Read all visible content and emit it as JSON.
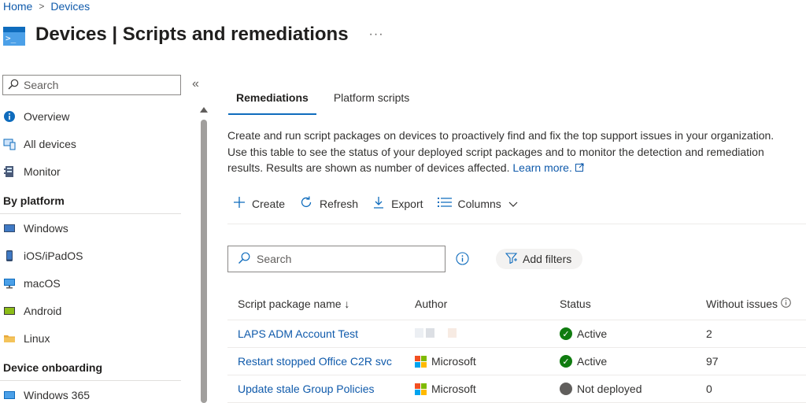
{
  "breadcrumb": {
    "home": "Home",
    "separator": ">",
    "current": "Devices"
  },
  "header": {
    "title_bold": "Devices",
    "title_rest": " | Scripts and remediations",
    "more": "···"
  },
  "sidebar": {
    "search_placeholder": "Search",
    "collapse": "«",
    "top_items": [
      {
        "label": "Overview",
        "icon": "info-icon"
      },
      {
        "label": "All devices",
        "icon": "devices-icon"
      },
      {
        "label": "Monitor",
        "icon": "monitor-icon"
      }
    ],
    "section_platform": "By platform",
    "platform_items": [
      {
        "label": "Windows",
        "icon": "windows-device-icon"
      },
      {
        "label": "iOS/iPadOS",
        "icon": "phone-icon"
      },
      {
        "label": "macOS",
        "icon": "desktop-icon"
      },
      {
        "label": "Android",
        "icon": "android-device-icon"
      },
      {
        "label": "Linux",
        "icon": "folder-icon"
      }
    ],
    "section_onboarding": "Device onboarding",
    "onboarding_items": [
      {
        "label": "Windows 365",
        "icon": "cloud-pc-icon"
      }
    ]
  },
  "tabs": [
    {
      "label": "Remediations",
      "active": true
    },
    {
      "label": "Platform scripts",
      "active": false
    }
  ],
  "description": {
    "text": "Create and run script packages on devices to proactively find and fix the top support issues in your organization. Use this table to see the status of your deployed script packages and to monitor the detection and remediation results. Results are shown as number of devices affected.",
    "link": "Learn more."
  },
  "toolbar": {
    "create": "Create",
    "refresh": "Refresh",
    "export": "Export",
    "columns": "Columns"
  },
  "filter": {
    "search_placeholder": "Search",
    "add_filters": "Add filters"
  },
  "table": {
    "headers": {
      "name": "Script package name ↓",
      "author": "Author",
      "status": "Status",
      "without_issues": "Without issues"
    },
    "rows": [
      {
        "name": "LAPS ADM Account Test",
        "author": "",
        "status": "Active",
        "without_issues": "2"
      },
      {
        "name": "Restart stopped Office C2R svc",
        "author": "Microsoft",
        "status": "Active",
        "without_issues": "97"
      },
      {
        "name": "Update stale Group Policies",
        "author": "Microsoft",
        "status": "Not deployed",
        "without_issues": "0"
      }
    ]
  },
  "colors": {
    "accent": "#0f6cbd",
    "link": "#0f5aab",
    "active_status": "#107c10",
    "inactive_status": "#605e5c"
  }
}
